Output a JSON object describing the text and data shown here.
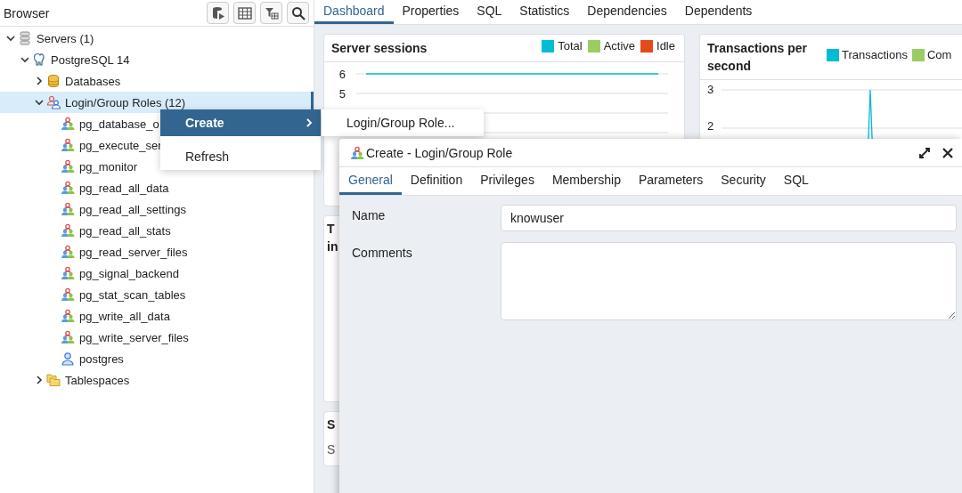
{
  "browser": {
    "title": "Browser",
    "tree": [
      {
        "label": "Servers (1)",
        "kind": "servers",
        "expanded": true,
        "selected": false,
        "children": [
          {
            "label": "PostgreSQL 14",
            "kind": "server",
            "expanded": true,
            "selected": false,
            "children": [
              {
                "label": "Databases",
                "kind": "databases",
                "expanded": false,
                "selected": false
              },
              {
                "label": "Login/Group Roles (12)",
                "kind": "roles",
                "expanded": true,
                "selected": true,
                "children": [
                  {
                    "label": "pg_database_o",
                    "kind": "group",
                    "selected": false
                  },
                  {
                    "label": "pg_execute_ser",
                    "kind": "group",
                    "selected": false
                  },
                  {
                    "label": "pg_monitor",
                    "kind": "group",
                    "selected": false
                  },
                  {
                    "label": "pg_read_all_data",
                    "kind": "group",
                    "selected": false
                  },
                  {
                    "label": "pg_read_all_settings",
                    "kind": "group",
                    "selected": false
                  },
                  {
                    "label": "pg_read_all_stats",
                    "kind": "group",
                    "selected": false
                  },
                  {
                    "label": "pg_read_server_files",
                    "kind": "group",
                    "selected": false
                  },
                  {
                    "label": "pg_signal_backend",
                    "kind": "group",
                    "selected": false
                  },
                  {
                    "label": "pg_stat_scan_tables",
                    "kind": "group",
                    "selected": false
                  },
                  {
                    "label": "pg_write_all_data",
                    "kind": "group",
                    "selected": false
                  },
                  {
                    "label": "pg_write_server_files",
                    "kind": "group",
                    "selected": false
                  },
                  {
                    "label": "postgres",
                    "kind": "user",
                    "selected": false
                  }
                ]
              },
              {
                "label": "Tablespaces",
                "kind": "tablespaces",
                "expanded": false,
                "selected": false
              }
            ]
          }
        ]
      }
    ]
  },
  "tabs": [
    {
      "label": "Dashboard",
      "selected": true
    },
    {
      "label": "Properties",
      "selected": false
    },
    {
      "label": "SQL",
      "selected": false
    },
    {
      "label": "Statistics",
      "selected": false
    },
    {
      "label": "Dependencies",
      "selected": false
    },
    {
      "label": "Dependents",
      "selected": false
    }
  ],
  "sessions_chart": {
    "chart_data": {
      "type": "line",
      "title": "Server sessions",
      "yticks": [
        5,
        6
      ],
      "ylim": [
        3,
        6
      ],
      "series": [
        {
          "name": "Total",
          "color": "#00bcd4",
          "values": [
            6,
            6,
            6,
            6,
            6,
            6,
            6,
            6,
            6,
            6,
            6,
            6,
            6,
            6,
            6,
            6
          ]
        },
        {
          "name": "Active",
          "color": "#9ccc65",
          "values": [
            null,
            null,
            null,
            null,
            null,
            null,
            null,
            null,
            null,
            null,
            null,
            null,
            null,
            null,
            null,
            null
          ]
        },
        {
          "name": "Idle",
          "color": "#e64a19",
          "values": [
            null,
            null,
            null,
            null,
            null,
            null,
            null,
            null,
            null,
            null,
            null,
            null,
            null,
            null,
            null,
            null
          ]
        }
      ]
    }
  },
  "transactions_chart": {
    "title": "Transactions per second",
    "legend": [
      {
        "name": "Transactions",
        "color": "#00bcd4"
      },
      {
        "name": "Com",
        "color": "#9ccc65"
      }
    ],
    "yticks": [
      "3",
      "2"
    ]
  },
  "panel_3": {
    "title_lines": [
      "T",
      "in"
    ]
  },
  "panel_4": {
    "title": "S",
    "tab": "S"
  },
  "context_menu": {
    "items": [
      {
        "label": "Create",
        "selected": true,
        "submenu": true
      },
      {
        "label": "Refresh",
        "selected": false,
        "submenu": false
      }
    ],
    "submenu": {
      "items": [
        "Login/Group Role..."
      ]
    }
  },
  "dialog": {
    "title": "Create - Login/Group Role",
    "tabs": [
      {
        "label": "General",
        "selected": true
      },
      {
        "label": "Definition",
        "selected": false
      },
      {
        "label": "Privileges",
        "selected": false
      },
      {
        "label": "Membership",
        "selected": false
      },
      {
        "label": "Parameters",
        "selected": false
      },
      {
        "label": "Security",
        "selected": false
      },
      {
        "label": "SQL",
        "selected": false
      }
    ],
    "fields": [
      {
        "label": "Name",
        "kind": "text",
        "value": "knowuser"
      },
      {
        "label": "Comments",
        "kind": "textarea"
      }
    ]
  }
}
